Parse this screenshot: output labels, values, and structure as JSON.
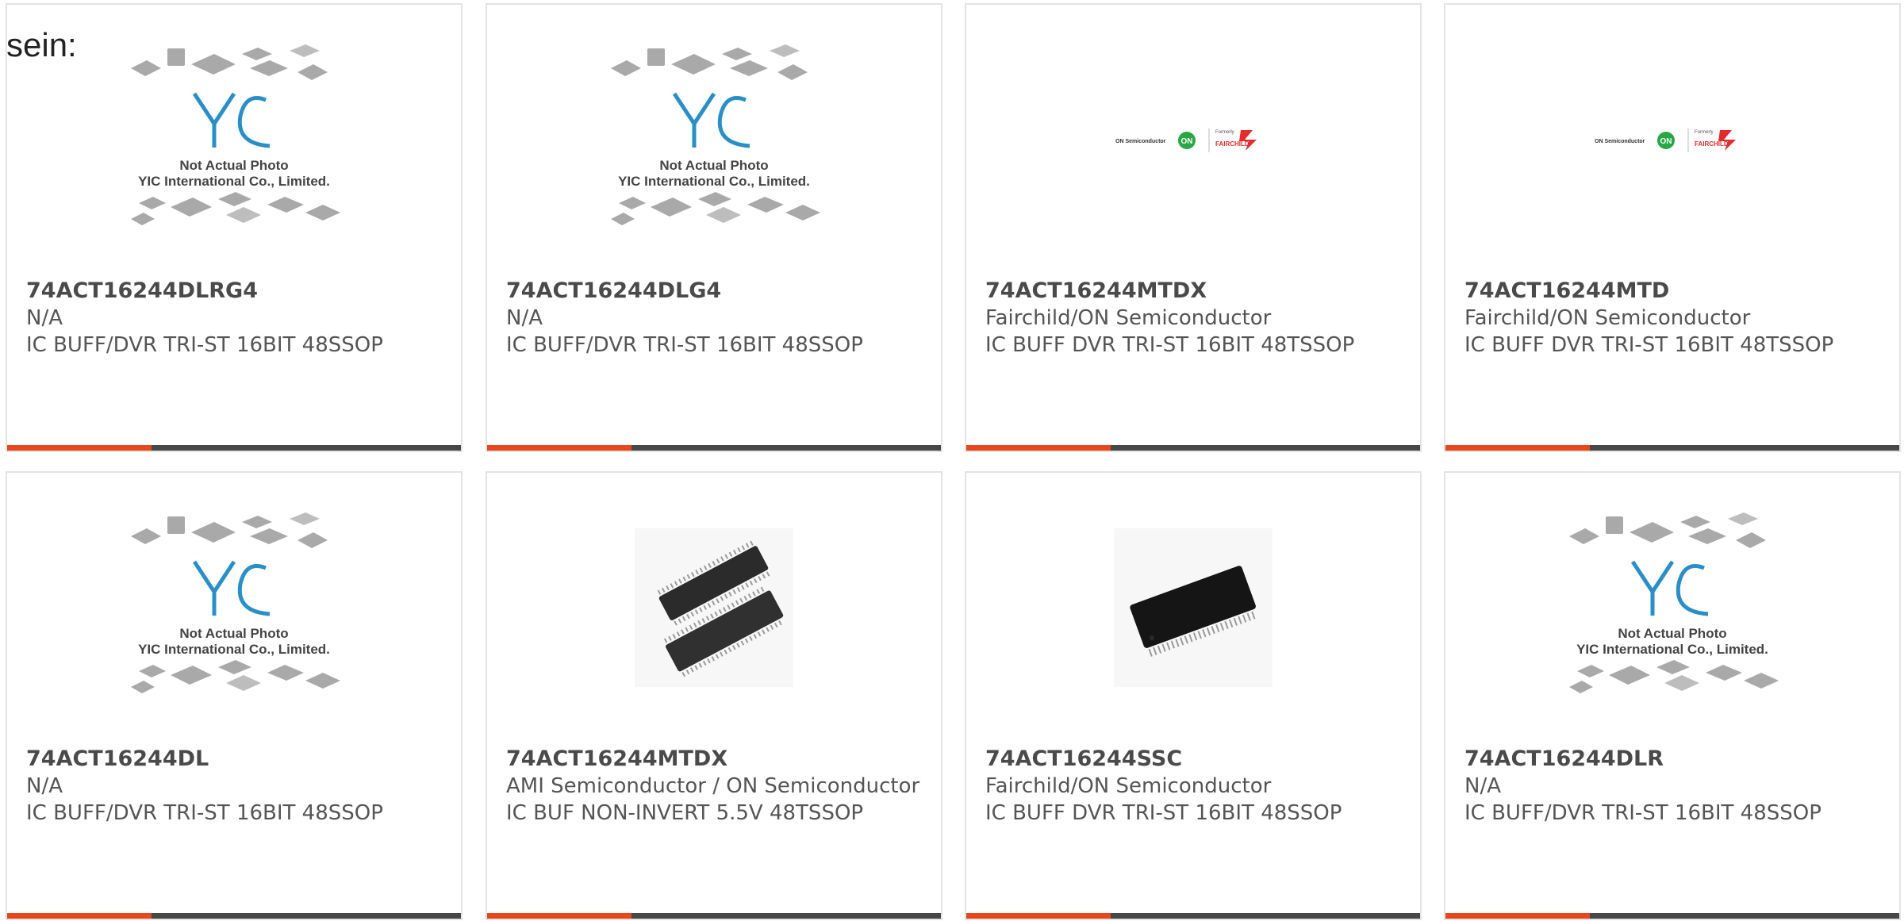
{
  "page_label": "sein:",
  "colors": {
    "accent": "#e8471c",
    "bar": "#474747",
    "card_border": "#e3e3e3",
    "yic_blue": "#2a8fc8"
  },
  "placeholder": {
    "line1": "Not Actual Photo",
    "line2": "YIC International Co., Limited."
  },
  "onsemi_logo": {
    "left": "ON Semiconductor",
    "mark": "ON",
    "top": "Formerly",
    "right": "FAIRCHILD."
  },
  "cards": [
    {
      "part": "74ACT16244DLRG4",
      "manufacturer": "N/A",
      "description": "IC BUFF/DVR TRI-ST 16BIT 48SSOP",
      "image": "yic-placeholder"
    },
    {
      "part": "74ACT16244DLG4",
      "manufacturer": "N/A",
      "description": "IC BUFF/DVR TRI-ST 16BIT 48SSOP",
      "image": "yic-placeholder"
    },
    {
      "part": "74ACT16244MTDX",
      "manufacturer": "Fairchild/ON Semiconductor",
      "description": "IC BUFF DVR TRI-ST 16BIT 48TSSOP",
      "image": "onsemi-fairchild-logo"
    },
    {
      "part": "74ACT16244MTD",
      "manufacturer": "Fairchild/ON Semiconductor",
      "description": "IC BUFF DVR TRI-ST 16BIT 48TSSOP",
      "image": "onsemi-fairchild-logo"
    },
    {
      "part": "74ACT16244DL",
      "manufacturer": "N/A",
      "description": "IC BUFF/DVR TRI-ST 16BIT 48SSOP",
      "image": "yic-placeholder"
    },
    {
      "part": "74ACT16244MTDX",
      "manufacturer": "AMI Semiconductor / ON Semiconductor",
      "description": "IC BUF NON-INVERT 5.5V 48TSSOP",
      "image": "tssop-chip-photo"
    },
    {
      "part": "74ACT16244SSC",
      "manufacturer": "Fairchild/ON Semiconductor",
      "description": "IC BUFF DVR TRI-ST 16BIT 48SSOP",
      "image": "ssop-chip-photo"
    },
    {
      "part": "74ACT16244DLR",
      "manufacturer": "N/A",
      "description": "IC BUFF/DVR TRI-ST 16BIT 48SSOP",
      "image": "yic-placeholder"
    }
  ]
}
